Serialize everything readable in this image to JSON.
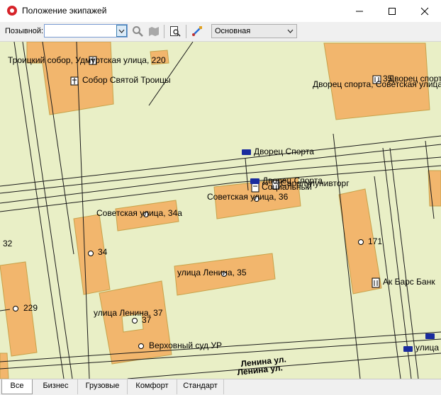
{
  "window": {
    "title": "Положение экипажей"
  },
  "toolbar": {
    "callsign_label": "Позывной:",
    "callsign_value": "",
    "layer_select": "Основная"
  },
  "map": {
    "labels": [
      "Троицкий собор, Удмуртская улица, 220",
      "Собор Святой Троицы",
      "Дворец спорта, Советская улица",
      "Дворец спорта",
      "35",
      "Дворец Спорта",
      "Дворец Спорта",
      "Социальный",
      "Сарапулунивторг",
      "Советская улица, 36",
      "Советская улица, 34а",
      "32",
      "34",
      "171",
      "улица Ленина, 35",
      "Ак Барс Банк",
      "229",
      "улица Ленина, 37",
      "37",
      "Верховный суд УР",
      "улица",
      "Ленина ул.",
      "Ленина ул."
    ]
  },
  "tabs": [
    "Все",
    "Бизнес",
    "Грузовые",
    "Комфорт",
    "Стандарт"
  ],
  "colors": {
    "map_bg": "#e9efc6",
    "building": "#f2b66d",
    "building_border": "#c7a24a",
    "bus": "#1a2b9e",
    "accent": "#0078d7"
  }
}
